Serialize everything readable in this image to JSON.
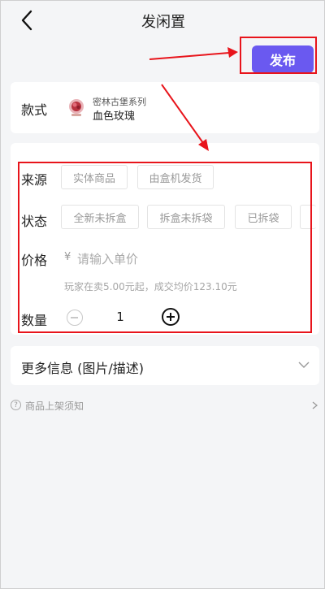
{
  "header": {
    "title": "发闲置",
    "back_icon": "chevron-left-icon"
  },
  "publish_label": "发布",
  "accent_color": "#6a59f0",
  "style_card": {
    "label": "款式",
    "series": "密林古堡系列",
    "product_name": "血色玫瑰"
  },
  "form": {
    "source": {
      "label": "来源",
      "options": [
        "实体商品",
        "由盒机发货"
      ]
    },
    "condition": {
      "label": "状态",
      "options": [
        "全新未拆盒",
        "拆盒未拆袋",
        "已拆袋"
      ]
    },
    "price": {
      "label": "价格",
      "currency": "¥",
      "placeholder": "请输入单价",
      "hint": "玩家在卖5.00元起，成交均价123.10元"
    },
    "quantity": {
      "label": "数量",
      "value": "1"
    }
  },
  "more_info": {
    "label": "更多信息 (图片/描述)"
  },
  "notice": {
    "label": "商品上架须知"
  },
  "annotation_color": "#e8141b"
}
